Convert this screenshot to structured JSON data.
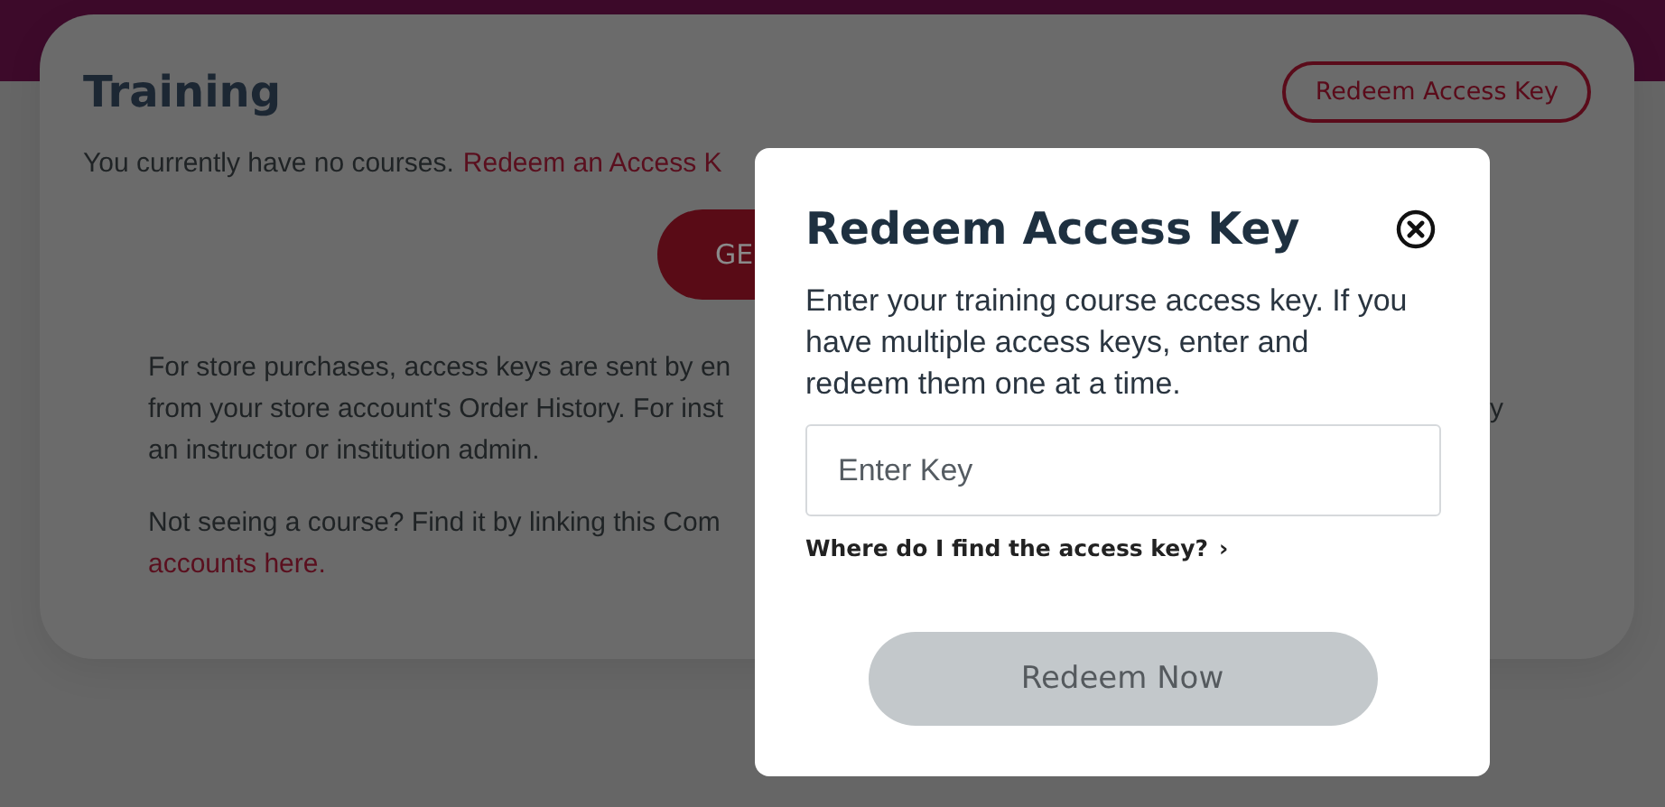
{
  "page": {
    "title": "Training",
    "redeem_button": "Redeem Access Key",
    "intro": "You currently have no courses.",
    "intro_link": "Redeem an Access K",
    "get_button": "GE",
    "paragraph_1_lines": [
      "For store purchases, access keys are sent by en",
      "from your store account's Order History. For inst",
      "an instructor or institution admin."
    ],
    "paragraph_1_tail": "y",
    "paragraph_2_lines": [
      "Not seeing a course? Find it by linking this Com"
    ],
    "paragraph_2_link": "accounts here."
  },
  "modal": {
    "title": "Redeem Access Key",
    "description": "Enter your training course access key. If you have multiple access keys, enter and redeem them one at a time.",
    "key_field": {
      "placeholder": "Enter Key"
    },
    "help_link": "Where do I find the access key?",
    "help_chevron": "›",
    "submit_button": {
      "label": "Redeem Now",
      "disabled": true
    }
  }
}
